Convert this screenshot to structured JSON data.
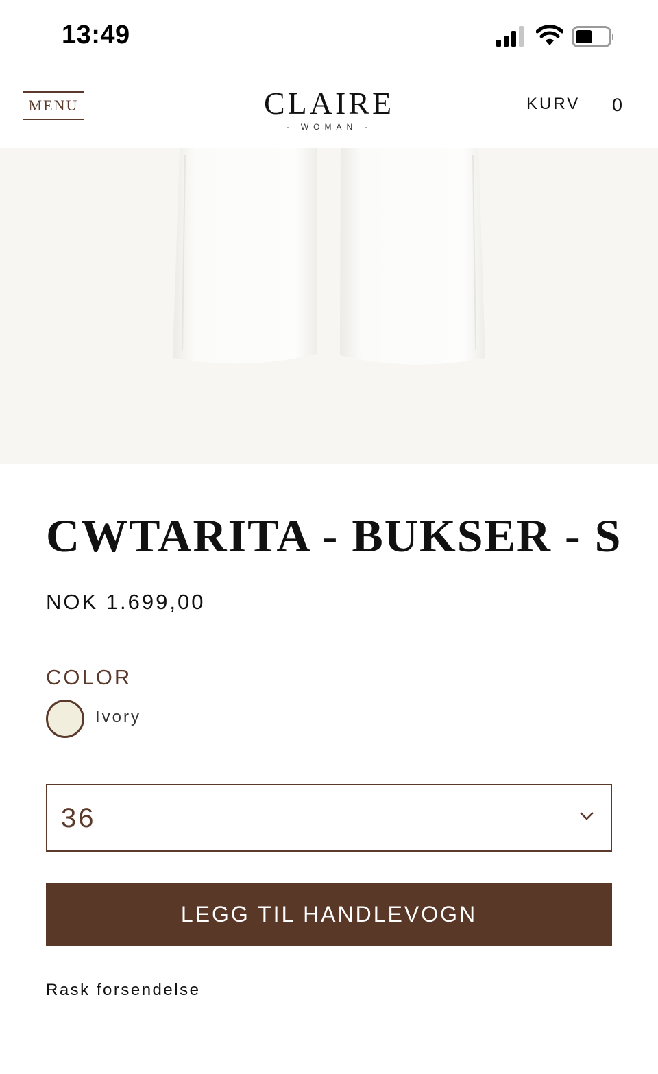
{
  "status_bar": {
    "time": "13:49",
    "icons": [
      "signal-icon",
      "wifi-icon",
      "battery-icon"
    ]
  },
  "header": {
    "menu_label": "MENU",
    "logo_main": "CLAIRE",
    "logo_sub": "- WOMAN -",
    "cart_label": "KURV",
    "cart_count": "0"
  },
  "product": {
    "title": "CWTARITA - BUKSER - S",
    "price": "NOK 1.699,00",
    "color_label": "COLOR",
    "color_name": "Ivory",
    "color_swatch_hex": "#f1eedd",
    "size_selected": "36",
    "add_to_cart_label": "LEGG TIL HANDLEVOGN",
    "shipping_note": "Rask forsendelse"
  },
  "colors": {
    "brand_brown": "#5a3828",
    "image_background": "#f7f6f2"
  }
}
